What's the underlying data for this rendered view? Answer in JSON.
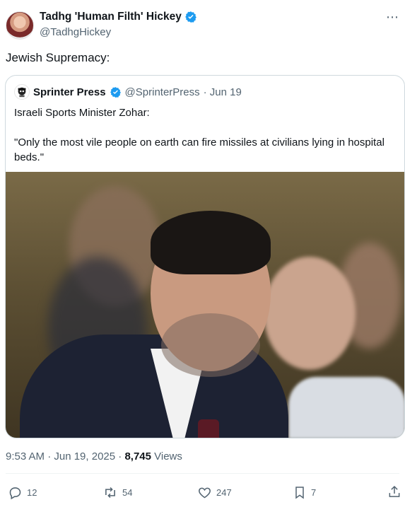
{
  "author": {
    "display_name": "Tadhg 'Human Filth' Hickey",
    "handle": "@TadhgHickey",
    "avatar_icon": "user-avatar",
    "verified_icon": "verified-badge-icon"
  },
  "tweet": {
    "text": "Jewish Supremacy:"
  },
  "quoted": {
    "display_name": "Sprinter Press",
    "handle": "@SprinterPress",
    "date": "· Jun 19",
    "lines": [
      "Israeli Sports Minister Zohar:",
      "\"Only the most vile people on earth can fire missiles at civilians lying in hospital beds.\""
    ]
  },
  "meta": {
    "time_date": "9:53 AM · Jun 19, 2025 · ",
    "views_count": "8,745",
    "views_label": " Views"
  },
  "actions": {
    "replies": "12",
    "reposts": "54",
    "likes": "247",
    "bookmarks": "7"
  },
  "colors": {
    "verified": "#1d9bf0",
    "secondary_text": "#536471",
    "border": "#cfd9de"
  }
}
